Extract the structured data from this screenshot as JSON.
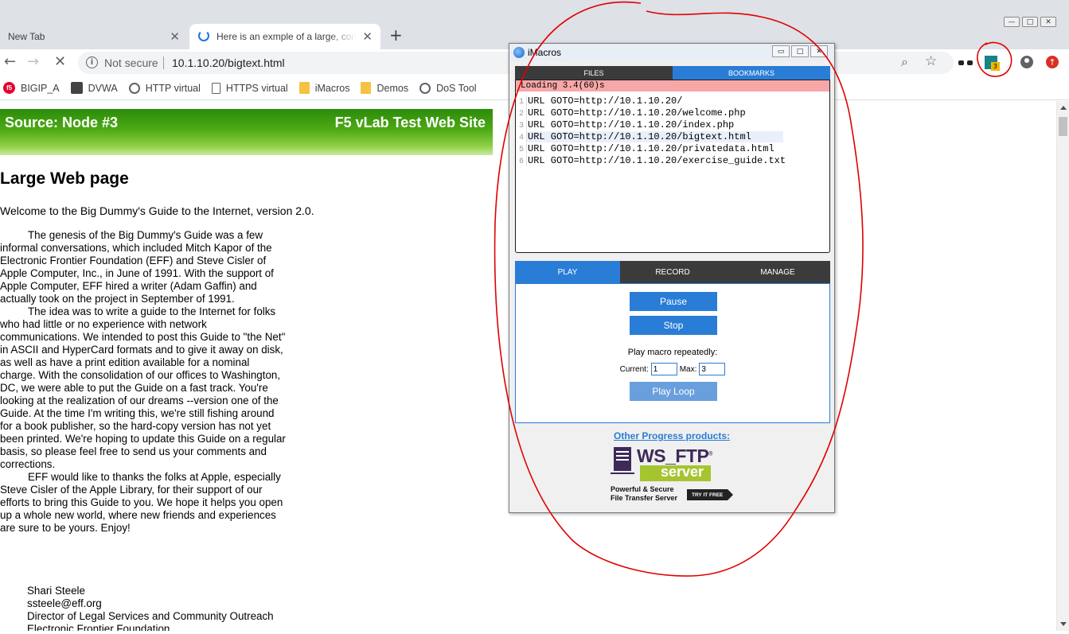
{
  "browser": {
    "window_controls": [
      "—",
      "□",
      "✕"
    ],
    "tabs": [
      {
        "title": "New Tab",
        "close": "✕"
      },
      {
        "title": "Here is an exmple of a large, complex webpage",
        "close": "✕"
      }
    ],
    "new_tab_symbol": "+",
    "nav": {
      "back": "←",
      "forward": "→",
      "reload": "✕"
    },
    "address": {
      "info_symbol": "i",
      "security_label": "Not secure",
      "url": "10.1.10.20/bigtext.html"
    },
    "zoom_symbol": "⌕",
    "star_symbol": "☆",
    "extensions": {
      "imacros_badge": "3",
      "update_symbol": "↑"
    },
    "bookmarks": [
      {
        "label": "BIGIP_A",
        "icon": "f5-icon"
      },
      {
        "label": "DVWA",
        "icon": "dvwa-icon"
      },
      {
        "label": "HTTP virtual",
        "icon": "globe-icon"
      },
      {
        "label": "HTTPS virtual",
        "icon": "page-icon"
      },
      {
        "label": "iMacros",
        "icon": "folder-icon"
      },
      {
        "label": "Demos",
        "icon": "folder-icon"
      },
      {
        "label": "DoS Tool",
        "icon": "globe-icon"
      }
    ]
  },
  "page": {
    "banner_left": "Source: Node #3",
    "banner_right": "F5 vLab Test Web Site",
    "heading": "Large Web page",
    "welcome": "Welcome to the Big Dummy's Guide to the Internet, version 2.0.",
    "paragraphs": [
      "The genesis of the Big Dummy's Guide was a few informal conversations, which included Mitch Kapor of the Electronic Frontier Foundation (EFF) and Steve Cisler of Apple Computer, Inc., in June of 1991. With the support of Apple Computer, EFF hired a writer (Adam Gaffin) and actually took on the project in September of 1991.",
      "The idea was to write a guide to the Internet for folks who had little or no experience with network communications. We intended to post this Guide to \"the Net\" in ASCII and HyperCard formats and to give it away on disk, as well as have a print edition available for a nominal charge. With the consolidation of our offices to Washington, DC, we were able to put the Guide on a fast track. You're looking at the realization of our dreams --version one of the Guide. At the time I'm writing this, we're still fishing around for a book publisher, so the hard-copy version has not yet been printed. We're hoping to update this Guide on a regular basis, so please feel free to send us your comments and corrections.",
      "EFF would like to thanks the folks at Apple, especially Steve Cisler of the Apple Library, for their support of our efforts to bring this Guide to you. We hope it helps you open up a whole new world, where new friends and experiences are sure to be yours. Enjoy!"
    ],
    "signature": [
      "Shari Steele",
      "ssteele@eff.org",
      "Director of Legal Services and Community Outreach",
      "Electronic Frontier Foundation"
    ]
  },
  "imacros": {
    "title": "iMacros",
    "window_controls": [
      "▭",
      "□",
      "✕"
    ],
    "tabs": {
      "files": "FILES",
      "bookmarks": "BOOKMARKS"
    },
    "status": "Loading 3.4(60)s",
    "lines": [
      {
        "num": "1",
        "code": "URL GOTO=http://10.1.10.20/"
      },
      {
        "num": "2",
        "code": "URL GOTO=http://10.1.10.20/welcome.php"
      },
      {
        "num": "3",
        "code": "URL GOTO=http://10.1.10.20/index.php"
      },
      {
        "num": "4",
        "code": "URL GOTO=http://10.1.10.20/bigtext.html"
      },
      {
        "num": "5",
        "code": "URL GOTO=http://10.1.10.20/privatedata.html"
      },
      {
        "num": "6",
        "code": "URL GOTO=http://10.1.10.20/exercise_guide.txt"
      }
    ],
    "control_tabs": {
      "play": "PLAY",
      "record": "RECORD",
      "manage": "MANAGE"
    },
    "pause_label": "Pause",
    "stop_label": "Stop",
    "repeat_label": "Play macro repeatedly:",
    "current_label": "Current:",
    "current_value": "1",
    "max_label": "Max:",
    "max_value": "3",
    "play_loop_label": "Play Loop",
    "promo_link": "Other Progress products:",
    "promo": {
      "product_ws": "WS_FTP",
      "product_reg": "®",
      "product_server": "server",
      "tagline1": "Powerful & Secure",
      "tagline2": "File Transfer Server",
      "try_label": "TRY IT FREE"
    }
  },
  "annotation_color": "#e00000"
}
